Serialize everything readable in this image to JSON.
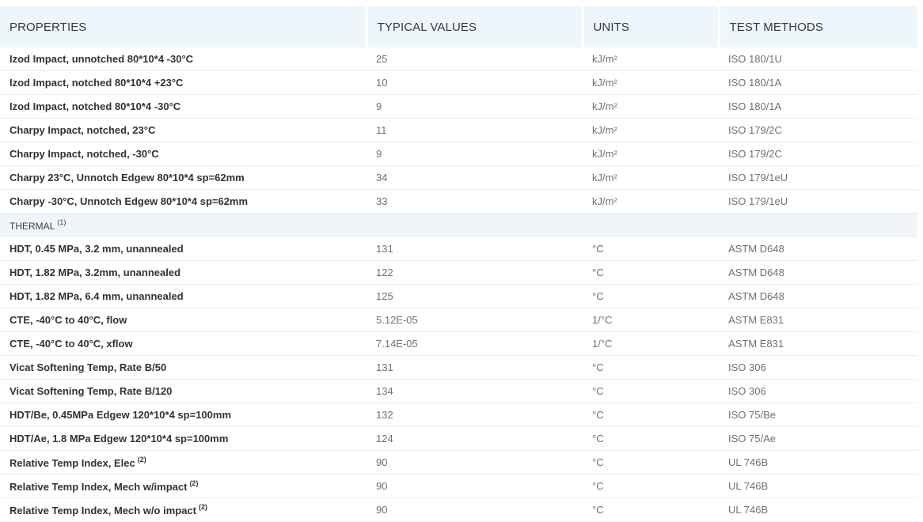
{
  "headers": {
    "properties": "PROPERTIES",
    "typical_values": "TYPICAL VALUES",
    "units": "UNITS",
    "test_methods": "TEST METHODS"
  },
  "rows": [
    {
      "type": "data",
      "property": "Izod Impact, unnotched 80*10*4 -30°C",
      "note": "",
      "value": "25",
      "unit": "kJ/m²",
      "method": "ISO 180/1U"
    },
    {
      "type": "data",
      "property": "Izod Impact, notched 80*10*4 +23°C",
      "note": "",
      "value": "10",
      "unit": "kJ/m²",
      "method": "ISO 180/1A"
    },
    {
      "type": "data",
      "property": "Izod Impact, notched 80*10*4 -30°C",
      "note": "",
      "value": "9",
      "unit": "kJ/m²",
      "method": "ISO 180/1A"
    },
    {
      "type": "data",
      "property": "Charpy Impact, notched, 23°C",
      "note": "",
      "value": "11",
      "unit": "kJ/m²",
      "method": "ISO 179/2C"
    },
    {
      "type": "data",
      "property": "Charpy Impact, notched, -30°C",
      "note": "",
      "value": "9",
      "unit": "kJ/m²",
      "method": "ISO 179/2C"
    },
    {
      "type": "data",
      "property": "Charpy 23°C, Unnotch Edgew 80*10*4 sp=62mm",
      "note": "",
      "value": "34",
      "unit": "kJ/m²",
      "method": "ISO 179/1eU"
    },
    {
      "type": "data",
      "property": "Charpy -30°C, Unnotch Edgew 80*10*4 sp=62mm",
      "note": "",
      "value": "33",
      "unit": "kJ/m²",
      "method": "ISO 179/1eU"
    },
    {
      "type": "section",
      "property": "THERMAL",
      "note": "(1)"
    },
    {
      "type": "data",
      "property": "HDT, 0.45 MPa, 3.2 mm, unannealed",
      "note": "",
      "value": "131",
      "unit": "°C",
      "method": "ASTM D648"
    },
    {
      "type": "data",
      "property": "HDT, 1.82 MPa, 3.2mm, unannealed",
      "note": "",
      "value": "122",
      "unit": "°C",
      "method": "ASTM D648"
    },
    {
      "type": "data",
      "property": "HDT, 1.82 MPa, 6.4 mm, unannealed",
      "note": "",
      "value": "125",
      "unit": "°C",
      "method": "ASTM D648"
    },
    {
      "type": "data",
      "property": "CTE, -40°C to 40°C, flow",
      "note": "",
      "value": "5.12E-05",
      "unit": "1/°C",
      "method": "ASTM E831"
    },
    {
      "type": "data",
      "property": "CTE, -40°C to 40°C, xflow",
      "note": "",
      "value": "7.14E-05",
      "unit": "1/°C",
      "method": "ASTM E831"
    },
    {
      "type": "data",
      "property": "Vicat Softening Temp, Rate B/50",
      "note": "",
      "value": "131",
      "unit": "°C",
      "method": "ISO 306"
    },
    {
      "type": "data",
      "property": "Vicat Softening Temp, Rate B/120",
      "note": "",
      "value": "134",
      "unit": "°C",
      "method": "ISO 306"
    },
    {
      "type": "data",
      "property": "HDT/Be, 0.45MPa Edgew 120*10*4 sp=100mm",
      "note": "",
      "value": "132",
      "unit": "°C",
      "method": "ISO 75/Be"
    },
    {
      "type": "data",
      "property": "HDT/Ae, 1.8 MPa Edgew 120*10*4 sp=100mm",
      "note": "",
      "value": "124",
      "unit": "°C",
      "method": "ISO 75/Ae"
    },
    {
      "type": "data",
      "property": "Relative Temp Index, Elec",
      "note": "(2)",
      "value": "90",
      "unit": "°C",
      "method": "UL 746B"
    },
    {
      "type": "data",
      "property": "Relative Temp Index, Mech w/impact",
      "note": "(2)",
      "value": "90",
      "unit": "°C",
      "method": "UL 746B"
    },
    {
      "type": "data",
      "property": "Relative Temp Index, Mech w/o impact",
      "note": "(2)",
      "value": "90",
      "unit": "°C",
      "method": "UL 746B"
    }
  ]
}
